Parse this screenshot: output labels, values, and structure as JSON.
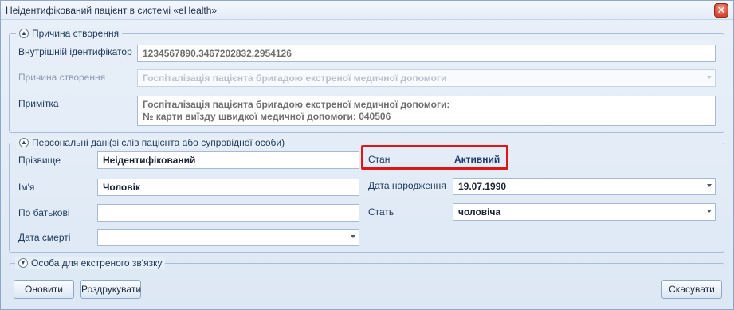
{
  "window": {
    "title": "Неідентифікований пацієнт в системі «eHealth»"
  },
  "reason_group": {
    "header": "Причина створення",
    "internal_id_label": "Внутрішній ідентифікатор",
    "internal_id_value": "1234567890.3467202832.2954126",
    "reason_label": "Причина створення",
    "reason_value": "Госпіталізація пацієнта бригадою екстреної медичної допомоги",
    "note_label": "Примітка",
    "note_line1": "Госпіталізація пацієнта бригадою екстреної медичної допомоги:",
    "note_line2": "№ карти виїзду швидкої медичної допомоги: 040506"
  },
  "personal_group": {
    "header": "Персональні дані(зі слів пацієнта або супровідної особи)",
    "surname_label": "Прізвище",
    "surname_value": "Неідентифікований",
    "name_label": "Ім'я",
    "name_value": "Чоловік",
    "patronymic_label": "По батькові",
    "patronymic_value": "",
    "death_date_label": "Дата смерті",
    "death_date_value": "",
    "status_label": "Стан",
    "status_value": "Активний",
    "birth_date_label": "Дата народження",
    "birth_date_value": "19.07.1990",
    "sex_label": "Стать",
    "sex_value": "чоловіча"
  },
  "emergency_group": {
    "header": "Особа для екстреного зв'язку"
  },
  "buttons": {
    "refresh": "Оновити",
    "print": "Роздрукувати",
    "cancel": "Скасувати"
  },
  "colors": {
    "highlight": "#e01616",
    "accent": "#1f3a6e"
  }
}
